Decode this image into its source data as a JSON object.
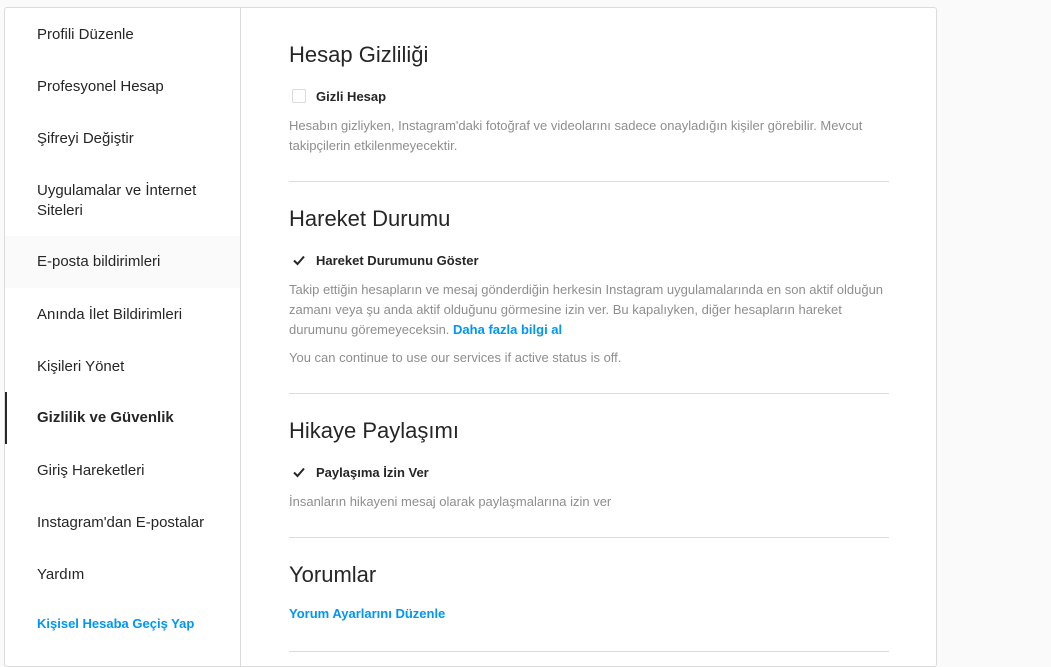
{
  "sidebar": {
    "items": [
      {
        "label": "Profili Düzenle"
      },
      {
        "label": "Profesyonel Hesap"
      },
      {
        "label": "Şifreyi Değiştir"
      },
      {
        "label": "Uygulamalar ve İnternet Siteleri"
      },
      {
        "label": "E-posta bildirimleri"
      },
      {
        "label": "Anında İlet Bildirimleri"
      },
      {
        "label": "Kişileri Yönet"
      },
      {
        "label": "Gizlilik ve Güvenlik"
      },
      {
        "label": "Giriş Hareketleri"
      },
      {
        "label": "Instagram'dan E-postalar"
      },
      {
        "label": "Yardım"
      }
    ],
    "switch_link": "Kişisel Hesaba Geçiş Yap"
  },
  "privacy": {
    "title": "Hesap Gizliliği",
    "checkbox_label": "Gizli Hesap",
    "checked": false,
    "description": "Hesabın gizliyken, Instagram'daki fotoğraf ve videolarını sadece onayladığın kişiler görebilir. Mevcut takipçilerin etkilenmeyecektir."
  },
  "activity": {
    "title": "Hareket Durumu",
    "checkbox_label": "Hareket Durumunu Göster",
    "checked": true,
    "description": "Takip ettiğin hesapların ve mesaj gönderdiğin herkesin Instagram uygulamalarında en son aktif olduğun zamanı veya şu anda aktif olduğunu görmesine izin ver. Bu kapalıyken, diğer hesapların hareket durumunu göremeyeceksin.",
    "learn_more": "Daha fazla bilgi al",
    "note": "You can continue to use our services if active status is off."
  },
  "story": {
    "title": "Hikaye Paylaşımı",
    "checkbox_label": "Paylaşıma İzin Ver",
    "checked": true,
    "description": "İnsanların hikayeni mesaj olarak paylaşmalarına izin ver"
  },
  "comments": {
    "title": "Yorumlar",
    "edit_link": "Yorum Ayarlarını Düzenle"
  },
  "colors": {
    "accent": "#0095f6",
    "text": "#262626",
    "muted": "#8e8e8e",
    "border": "#dbdbdb"
  }
}
